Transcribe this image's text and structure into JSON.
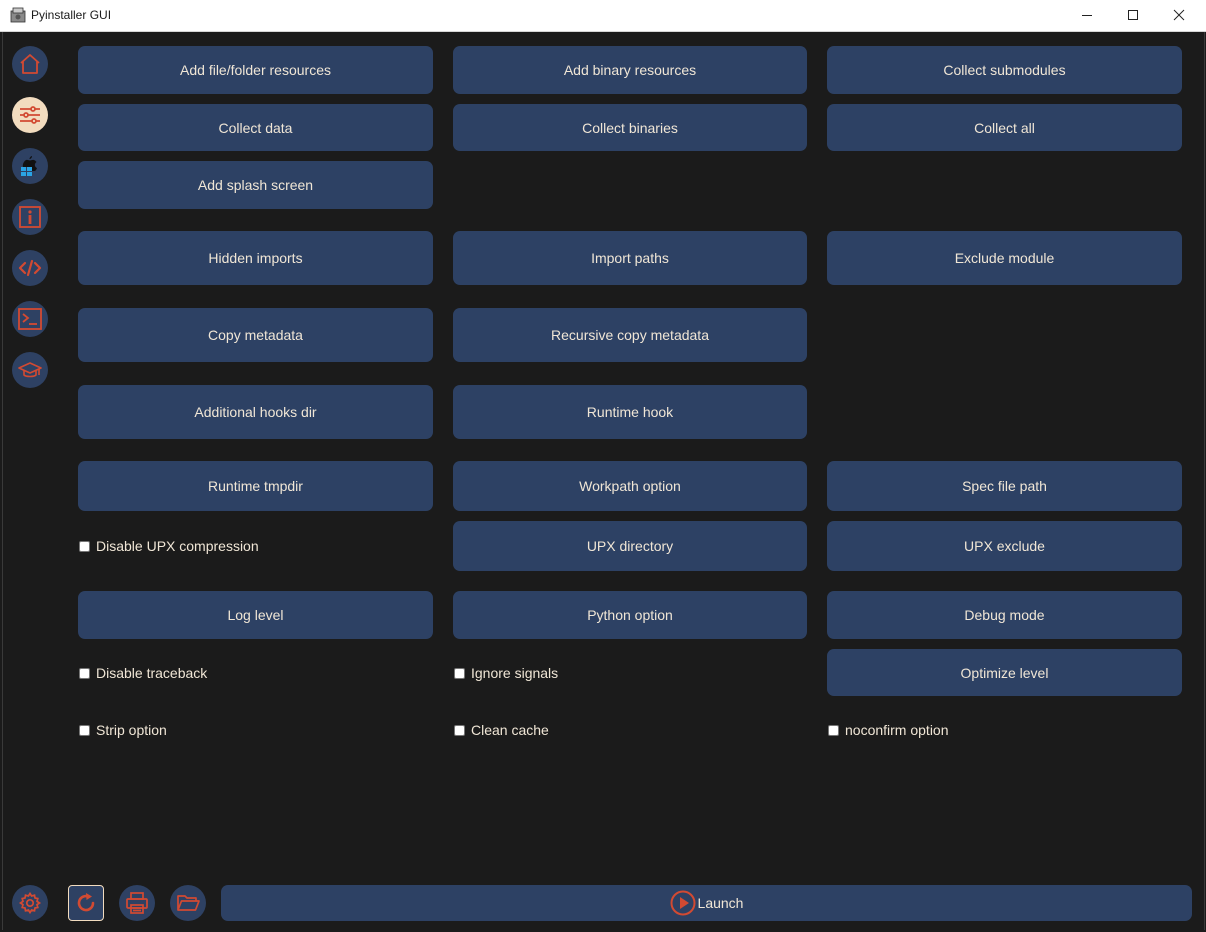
{
  "window": {
    "title": "Pyinstaller GUI"
  },
  "sidebar": {
    "items": [
      {
        "name": "home-icon"
      },
      {
        "name": "sliders-icon",
        "active": true
      },
      {
        "name": "os-icon"
      },
      {
        "name": "info-icon"
      },
      {
        "name": "code-icon"
      },
      {
        "name": "terminal-icon"
      },
      {
        "name": "graduation-cap-icon"
      }
    ]
  },
  "buttons": {
    "add_file_folder": "Add file/folder resources",
    "add_binary": "Add binary resources",
    "collect_submodules": "Collect submodules",
    "collect_data": "Collect data",
    "collect_binaries": "Collect binaries",
    "collect_all": "Collect all",
    "add_splash": "Add splash screen",
    "hidden_imports": "Hidden imports",
    "import_paths": "Import paths",
    "exclude_module": "Exclude module",
    "copy_metadata": "Copy metadata",
    "recursive_copy_metadata": "Recursive copy metadata",
    "additional_hooks_dir": "Additional hooks dir",
    "runtime_hook": "Runtime hook",
    "runtime_tmpdir": "Runtime tmpdir",
    "workpath_option": "Workpath option",
    "spec_file_path": "Spec file path",
    "upx_directory": "UPX directory",
    "upx_exclude": "UPX exclude",
    "log_level": "Log level",
    "python_option": "Python option",
    "debug_mode": "Debug mode",
    "optimize_level": "Optimize level"
  },
  "checkboxes": {
    "disable_upx": {
      "label": "Disable UPX compression",
      "checked": false
    },
    "disable_traceback": {
      "label": "Disable traceback",
      "checked": false
    },
    "ignore_signals": {
      "label": "Ignore signals",
      "checked": false
    },
    "strip_option": {
      "label": "Strip option",
      "checked": false
    },
    "clean_cache": {
      "label": "Clean cache",
      "checked": false
    },
    "noconfirm_option": {
      "label": "noconfirm option",
      "checked": false
    }
  },
  "bottom": {
    "launch_label": "Launch"
  },
  "colors": {
    "background": "#1b1b1b",
    "button": "#2d4164",
    "text": "#f0e6d6",
    "accent_red": "#d24a32",
    "active_sidebar": "#f2dcbf"
  }
}
